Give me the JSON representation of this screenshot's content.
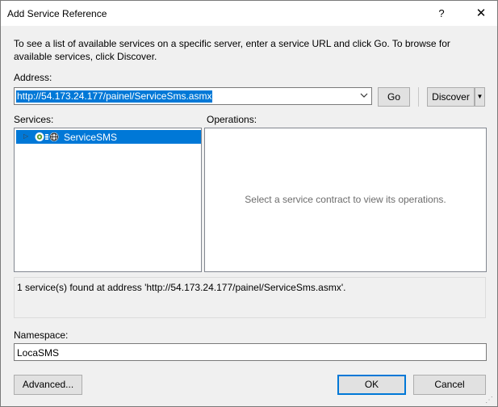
{
  "window": {
    "title": "Add Service Reference",
    "help_label": "?",
    "close_label": "✕"
  },
  "intro": "To see a list of available services on a specific server, enter a service URL and click Go. To browse for available services, click Discover.",
  "address": {
    "label": "Address:",
    "value": "http://54.173.24.177/painel/ServiceSms.asmx",
    "dropdown_icon": "chevron-down-icon"
  },
  "buttons": {
    "go": "Go",
    "discover": "Discover",
    "advanced": "Advanced...",
    "ok": "OK",
    "cancel": "Cancel"
  },
  "services": {
    "label": "Services:",
    "items": [
      {
        "label": "ServiceSMS",
        "selected": true
      }
    ]
  },
  "operations": {
    "label": "Operations:",
    "empty_text": "Select a service contract to view its operations."
  },
  "status": "1 service(s) found at address 'http://54.173.24.177/painel/ServiceSms.asmx'.",
  "namespace": {
    "label": "Namespace:",
    "value": "LocaSMS"
  },
  "colors": {
    "selection": "#0078d7",
    "dialog_bg": "#f0f0f0"
  }
}
